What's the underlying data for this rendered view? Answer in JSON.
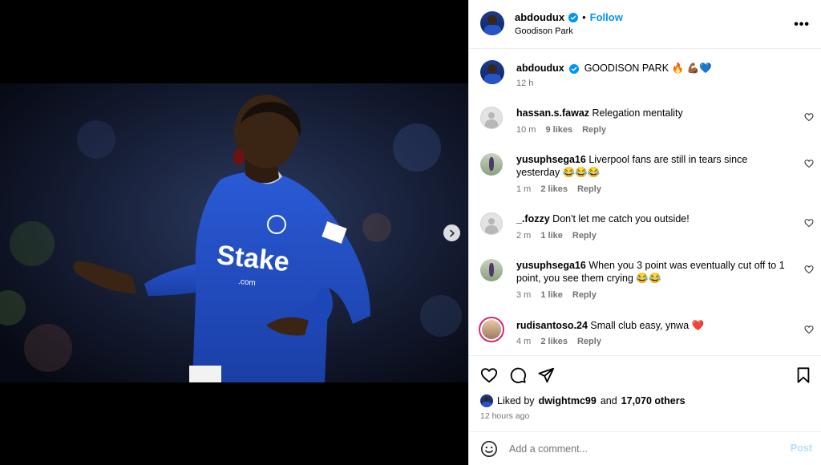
{
  "post": {
    "author": "abdoudux",
    "follow_label": "Follow",
    "separator": "•",
    "location": "Goodison Park",
    "more_label": "•••",
    "caption": "GOODISON PARK 🔥 💪🏾💙",
    "caption_age": "12 h"
  },
  "media": {
    "carousel_index": 1,
    "carousel_count": 2
  },
  "comments": [
    {
      "user": "hassan.s.fawaz",
      "text": "Relegation mentality",
      "age": "10 m",
      "likes": "9 likes",
      "reply": "Reply",
      "avatar": "default-avatar"
    },
    {
      "user": "yusuphsega16",
      "text": "Liverpool fans are still in tears since yesterday 😂😂😂",
      "age": "1 m",
      "likes": "2 likes",
      "reply": "Reply",
      "avatar": "player-avatar"
    },
    {
      "user": "_.fozzy",
      "text": "Don't let me catch you outside!",
      "age": "2 m",
      "likes": "1 like",
      "reply": "Reply",
      "avatar": "default-avatar"
    },
    {
      "user": "yusuphsega16",
      "text": "When you 3 point was eventually cut off to 1 point, you see them crying 😂😂",
      "age": "3 m",
      "likes": "1 like",
      "reply": "Reply",
      "avatar": "player-avatar"
    },
    {
      "user": "rudisantoso.24",
      "text": "Small club easy, ynwa ❤️",
      "age": "4 m",
      "likes": "2 likes",
      "reply": "Reply",
      "avatar": "story-avatar"
    }
  ],
  "engagement": {
    "liked_by_prefix": "Liked by",
    "liked_by_user": "dwightmc99",
    "and": "and",
    "others": "17,070 others",
    "posted_ago": "12 hours ago"
  },
  "composer": {
    "placeholder": "Add a comment...",
    "post_label": "Post"
  },
  "colors": {
    "accent": "#0095f6",
    "post_disabled": "#b2dffc",
    "everton_blue": "#1f4cc4",
    "like_red": "#ff3040"
  }
}
